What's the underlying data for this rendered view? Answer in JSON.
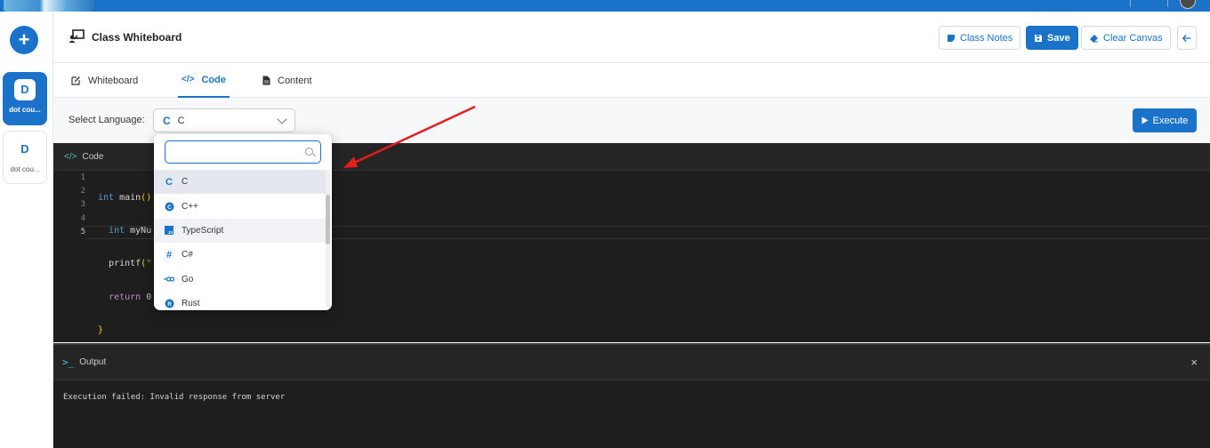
{
  "header": {
    "title": "Class Whiteboard",
    "buttons": {
      "class_notes": "Class Notes",
      "save": "Save",
      "clear_canvas": "Clear Canvas"
    }
  },
  "sidebar": {
    "cards": [
      {
        "letter": "D",
        "label": "dot cou..."
      },
      {
        "letter": "D",
        "label": "dot cou..."
      }
    ]
  },
  "tabs": [
    {
      "label": "Whiteboard"
    },
    {
      "label": "Code"
    },
    {
      "label": "Content"
    }
  ],
  "toolbar": {
    "language_label": "Select Language:",
    "selected_language": "C",
    "execute_label": "Execute"
  },
  "code": {
    "header": "Code",
    "line_numbers": [
      "1",
      "2",
      "3",
      "4",
      "5"
    ]
  },
  "dropdown": {
    "search_value": "",
    "options": [
      {
        "label": "C",
        "icon": "c-language-icon"
      },
      {
        "label": "C++",
        "icon": "cpp-language-icon"
      },
      {
        "label": "TypeScript",
        "icon": "typescript-language-icon"
      },
      {
        "label": "C#",
        "icon": "csharp-language-icon"
      },
      {
        "label": "Go",
        "icon": "go-language-icon"
      },
      {
        "label": "Rust",
        "icon": "rust-language-icon"
      }
    ]
  },
  "output": {
    "header": "Output",
    "close": "×",
    "text": "Execution failed: Invalid response from server"
  },
  "colors": {
    "primary": "#1a73c9",
    "editor_bg": "#1e1e1e",
    "annotation_arrow": "#e41e1e"
  }
}
